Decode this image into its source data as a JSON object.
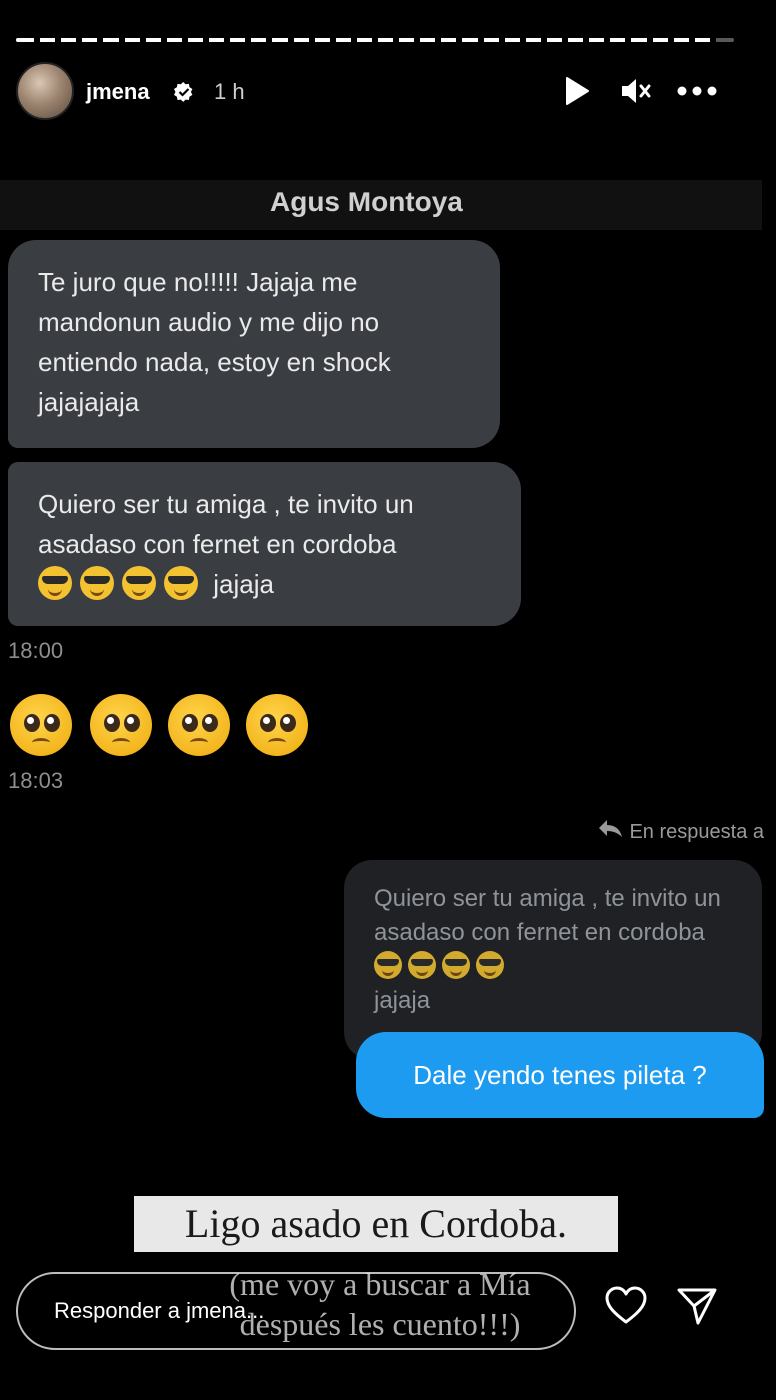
{
  "story": {
    "progress": 0.97,
    "header": {
      "username": "jmena",
      "time_ago": "1 h",
      "icons": [
        "play-icon",
        "mute-icon",
        "more-icon"
      ]
    }
  },
  "chat": {
    "contact_name": "Agus Montoya",
    "messages_in": [
      "Te juro que no!!!!! Jajaja me mandonun audio y me dijo no entiendo nada, estoy en shock jajajajaja",
      "Quiero ser tu amiga , te invito un asadaso con fernet en cordoba"
    ],
    "message_suffix": "jajaja",
    "emoji_cool_count": 4,
    "timestamp_1": "18:00",
    "pleading_emoji_count": 4,
    "timestamp_2": "18:03",
    "reply_label": "En respuesta a",
    "quoted_text": "Quiero ser tu amiga , te invito un asadaso con fernet en cordoba",
    "quoted_suffix": "jajaja",
    "sent_message": "Dale yendo tenes pileta ?"
  },
  "caption": {
    "title": "Ligo asado en Cordoba.",
    "subtitle_line1": "(me voy a buscar a Mía",
    "subtitle_line2": "después les cuento!!!)"
  },
  "footer": {
    "reply_placeholder": "Responder a jmena...",
    "icons": [
      "heart-icon",
      "send-icon"
    ]
  },
  "colors": {
    "sent_bubble": "#1d9bf0",
    "received_bubble": "#3a3d42",
    "background": "#000000"
  }
}
